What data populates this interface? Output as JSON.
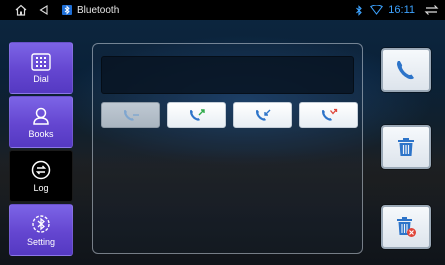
{
  "statusbar": {
    "app_title": "Bluetooth",
    "clock": "16:11",
    "icons": [
      "home-icon",
      "back-icon",
      "bluetooth-app-icon",
      "bluetooth-status-icon",
      "wifi-icon",
      "recent-apps-icon"
    ]
  },
  "sidebar": {
    "items": [
      {
        "label": "Dial",
        "icon": "dialpad-icon"
      },
      {
        "label": "Books",
        "icon": "contact-icon"
      },
      {
        "label": "Log",
        "icon": "swap-arrows-icon",
        "active": true
      },
      {
        "label": "Setting",
        "icon": "bluetooth-settings-icon"
      }
    ]
  },
  "log": {
    "number_display": "",
    "filters": [
      {
        "icon": "all-calls-icon",
        "selected": true
      },
      {
        "icon": "outgoing-call-icon"
      },
      {
        "icon": "incoming-call-icon"
      },
      {
        "icon": "missed-call-icon"
      }
    ]
  },
  "actions": [
    {
      "icon": "phone-call-icon"
    },
    {
      "icon": "trash-icon"
    },
    {
      "icon": "trash-all-icon"
    }
  ],
  "colors": {
    "accent_purple": "#6a4fd8",
    "clock_blue": "#3da3ff",
    "icon_blue": "#2d74c9",
    "missed_red": "#e0463a"
  }
}
